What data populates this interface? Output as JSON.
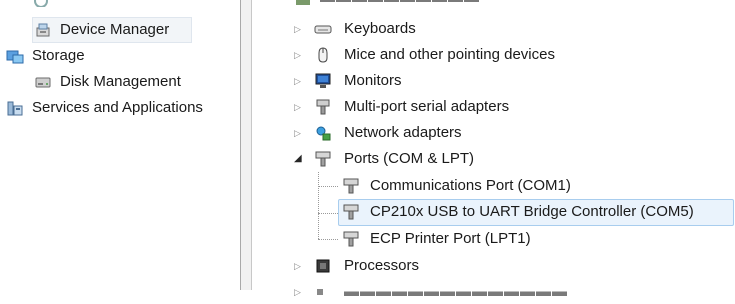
{
  "left_tree": {
    "items": [
      {
        "label": "Device Manager",
        "icon": "device-manager-icon"
      },
      {
        "label": "Storage",
        "icon": "storage-icon"
      },
      {
        "label": "Disk Management",
        "icon": "disk-management-icon"
      },
      {
        "label": "Services and Applications",
        "icon": "services-applications-icon"
      }
    ]
  },
  "device_tree": {
    "categories": [
      {
        "label": "Keyboards",
        "icon": "keyboard-icon"
      },
      {
        "label": "Mice and other pointing devices",
        "icon": "mouse-icon"
      },
      {
        "label": "Monitors",
        "icon": "monitor-icon"
      },
      {
        "label": "Multi-port serial adapters",
        "icon": "serial-adapter-icon"
      },
      {
        "label": "Network adapters",
        "icon": "network-adapter-icon"
      },
      {
        "label": "Ports (COM & LPT)",
        "icon": "port-icon"
      },
      {
        "label": "Processors",
        "icon": "processor-icon"
      }
    ],
    "ports_children": [
      {
        "label": "Communications Port (COM1)",
        "icon": "port-icon"
      },
      {
        "label": "CP210x USB to UART Bridge Controller (COM5)",
        "icon": "port-icon"
      },
      {
        "label": "ECP Printer Port (LPT1)",
        "icon": "port-icon"
      }
    ]
  },
  "colors": {
    "selection_fill": "#eaf3fc",
    "selection_border": "#a8cdee"
  }
}
